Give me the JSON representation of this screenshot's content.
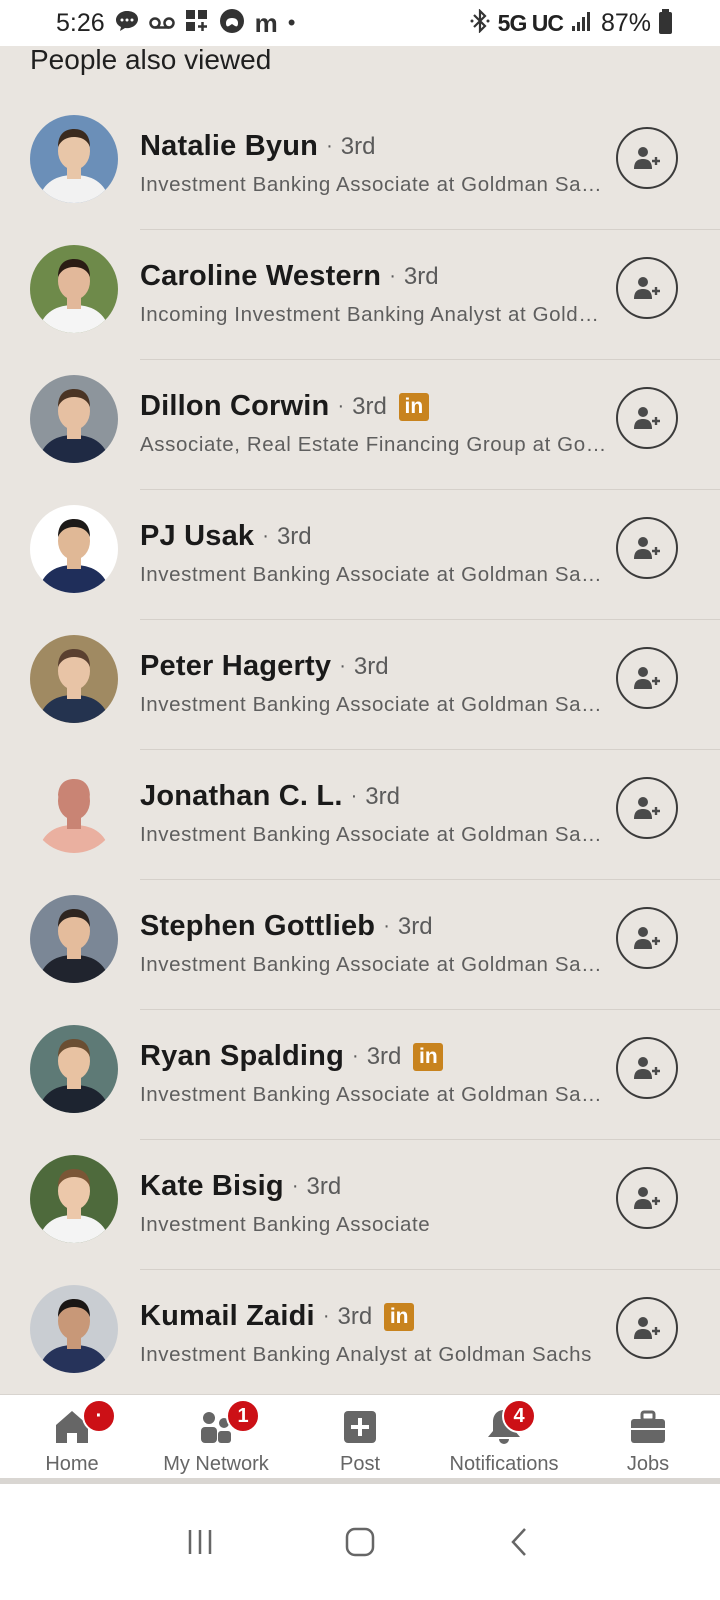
{
  "status_bar": {
    "time": "5:26",
    "network": "5G UC",
    "battery": "87%",
    "left_icons": [
      "message-icon",
      "voicemail-icon",
      "apps-icon",
      "game-icon",
      "m-icon",
      "dot-icon"
    ],
    "right_icons": [
      "bluetooth-icon",
      "signal-icon",
      "battery-icon"
    ]
  },
  "section": {
    "title": "People also viewed"
  },
  "people": [
    {
      "name": "Natalie Byun",
      "degree": "3rd",
      "linkedin_badge": false,
      "headline": "Investment Banking Associate at Goldman Sachs",
      "avatar": {
        "bg": "#6b8fb8",
        "skin": "#e8c6a8",
        "hair": "#3a2a1e",
        "top": "#f2f2f2"
      }
    },
    {
      "name": "Caroline Western",
      "degree": "3rd",
      "linkedin_badge": false,
      "headline": "Incoming Investment Banking Analyst at Goldman Sachs",
      "avatar": {
        "bg": "#6e8a4a",
        "skin": "#e2b89a",
        "hair": "#2a1c14",
        "top": "#f5f5f5"
      }
    },
    {
      "name": "Dillon Corwin",
      "degree": "3rd",
      "linkedin_badge": true,
      "headline": "Associate, Real Estate Financing Group at Goldman Sachs",
      "avatar": {
        "bg": "#8d959c",
        "skin": "#e6c0a2",
        "hair": "#4a3424",
        "top": "#1f2a44"
      }
    },
    {
      "name": "PJ Usak",
      "degree": "3rd",
      "linkedin_badge": false,
      "headline": "Investment Banking Associate at Goldman Sachs",
      "avatar": {
        "bg": "#ffffff",
        "skin": "#e0b896",
        "hair": "#1d1a18",
        "top": "#1f2e5a"
      }
    },
    {
      "name": "Peter Hagerty",
      "degree": "3rd",
      "linkedin_badge": false,
      "headline": "Investment Banking Associate at Goldman Sachs",
      "avatar": {
        "bg": "#a08a62",
        "skin": "#e8c4a6",
        "hair": "#5a4030",
        "top": "#24334f"
      }
    },
    {
      "name": "Jonathan C. L.",
      "degree": "3rd",
      "linkedin_badge": false,
      "headline": "Investment Banking Associate at Goldman Sachs",
      "avatar": {
        "bg": "#e9e5e0",
        "skin": "#c98474",
        "hair": "#c98474",
        "top": "#eab0a0"
      }
    },
    {
      "name": "Stephen Gottlieb",
      "degree": "3rd",
      "linkedin_badge": false,
      "headline": "Investment Banking Associate at Goldman Sachs",
      "avatar": {
        "bg": "#7b8796",
        "skin": "#e4bc9c",
        "hair": "#2e2520",
        "top": "#20242e"
      }
    },
    {
      "name": "Ryan Spalding",
      "degree": "3rd",
      "linkedin_badge": true,
      "headline": "Investment Banking Associate at Goldman Sachs",
      "avatar": {
        "bg": "#5e7a76",
        "skin": "#e8c2a2",
        "hair": "#6a4e32",
        "top": "#1d2430"
      }
    },
    {
      "name": "Kate Bisig",
      "degree": "3rd",
      "linkedin_badge": false,
      "headline": "Investment Banking Associate",
      "avatar": {
        "bg": "#4e6a3c",
        "skin": "#ecc8aa",
        "hair": "#7a5636",
        "top": "#f4f4f4"
      }
    },
    {
      "name": "Kumail Zaidi",
      "degree": "3rd",
      "linkedin_badge": true,
      "headline": "Investment Banking Analyst at Goldman Sachs",
      "avatar": {
        "bg": "#c9cdd2",
        "skin": "#c89878",
        "hair": "#1a1614",
        "top": "#26335a"
      }
    }
  ],
  "bottom_nav": {
    "items": [
      {
        "label": "Home",
        "icon": "home-icon",
        "badge": "·"
      },
      {
        "label": "My Network",
        "icon": "my-network-icon",
        "badge": "1"
      },
      {
        "label": "Post",
        "icon": "post-icon",
        "badge": ""
      },
      {
        "label": "Notifications",
        "icon": "bell-icon",
        "badge": "4"
      },
      {
        "label": "Jobs",
        "icon": "briefcase-icon",
        "badge": ""
      }
    ]
  },
  "system_nav": [
    "recent-apps-icon",
    "home-circle-icon",
    "back-icon"
  ],
  "colors": {
    "background": "#e9e5e0",
    "linkedin_badge": "#c8831e",
    "badge_red": "#cc1016"
  }
}
